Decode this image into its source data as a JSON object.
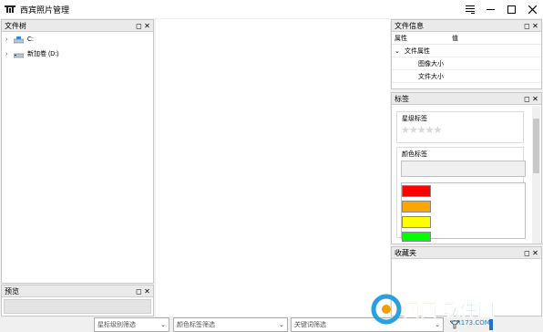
{
  "window": {
    "title": "西宾照片管理"
  },
  "file_tree": {
    "title": "文件树",
    "items": [
      {
        "label": "C:",
        "icon": "drive-c-icon"
      },
      {
        "label": "新加卷 (D:)",
        "icon": "drive-d-icon"
      }
    ]
  },
  "preview": {
    "title": "预览"
  },
  "file_info": {
    "title": "文件信息",
    "col_property": "属性",
    "col_value": "值",
    "group_label": "文件属性",
    "rows": [
      "图像大小",
      "文件大小"
    ]
  },
  "tags": {
    "title": "标签",
    "star_section": "星级标签",
    "stars": 0,
    "stars_max": 5,
    "color_section": "颜色标签",
    "colors": [
      "#ff0000",
      "#ffa500",
      "#ffff00",
      "#00ff00"
    ]
  },
  "favorites": {
    "title": "收藏夹"
  },
  "filters": {
    "star_placeholder": "星标级别筛选",
    "color_placeholder": "颜色标签筛选",
    "keyword_placeholder": "关键词筛选"
  },
  "watermark": {
    "text": "西西软件园",
    "sub": "CR173.COM"
  }
}
